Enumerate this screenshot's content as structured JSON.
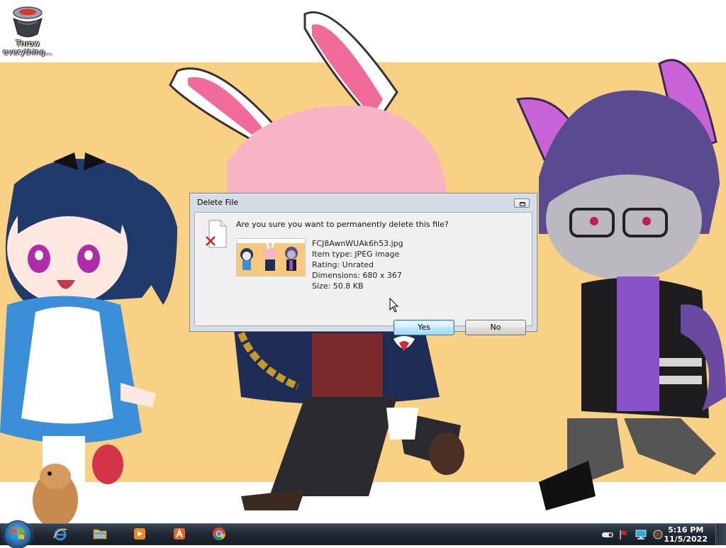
{
  "desktop": {
    "icons": [
      {
        "label": "Throw everything..."
      }
    ]
  },
  "dialog": {
    "title": "Delete File",
    "question": "Are you sure you want to permanently delete this file?",
    "file": {
      "name": "FCJ8AwnWUAk6h53.jpg",
      "item_type": "Item type: JPEG image",
      "rating": "Rating: Unrated",
      "dimensions": "Dimensions: 680 x 367",
      "size": "Size: 50.8 KB"
    },
    "buttons": {
      "yes": "Yes",
      "no": "No"
    }
  },
  "taskbar": {
    "pinned": [
      "internet-explorer-icon",
      "file-explorer-icon",
      "media-player-icon",
      "app-icon",
      "chrome-icon"
    ],
    "clock": {
      "time": "5:16 PM",
      "date": "11/5/2022"
    }
  },
  "colors": {
    "wallpaper_band": "#f8d184",
    "taskbar": "#1f2833",
    "dialog_frame": "#d4dce5",
    "default_button": "#bee6fd"
  }
}
